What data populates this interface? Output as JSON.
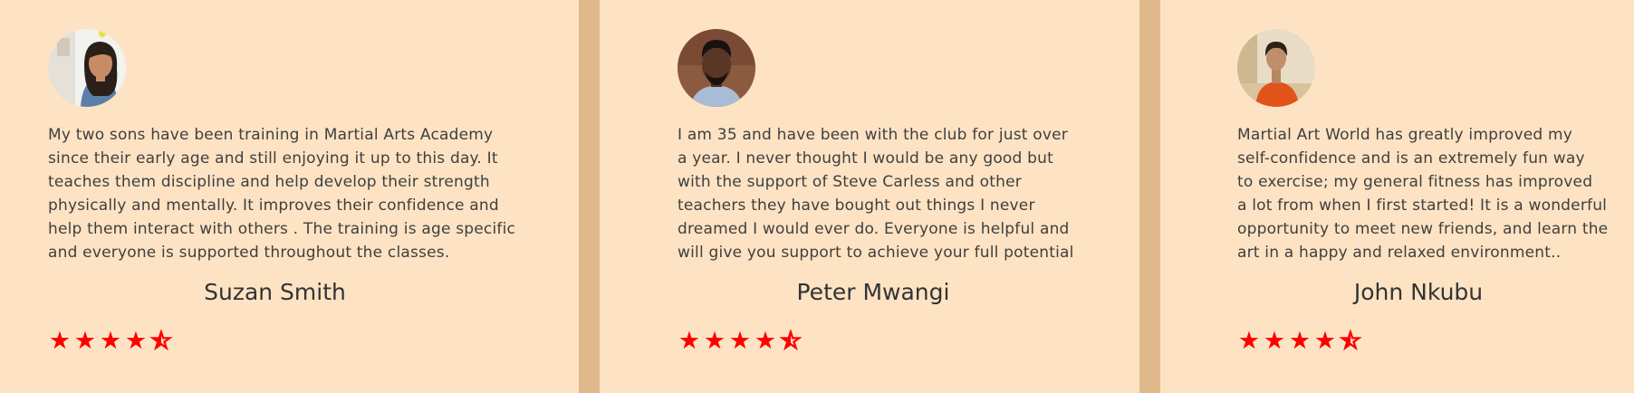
{
  "testimonials": [
    {
      "avatar_icon": "avatar-woman-photo",
      "quote_lines": [
        "My two sons have been training in Martial Arts Academy",
        "since their early age and still enjoying it up to this day. It",
        "teaches them discipline and help develop their strength",
        "physically and mentally. It improves their confidence and",
        "help them interact with others . The training is age specific",
        "and everyone is supported throughout the classes."
      ],
      "name": "Suzan Smith",
      "rating": 4.5,
      "stars": [
        "★",
        "★",
        "★",
        "★"
      ],
      "half_star": "★"
    },
    {
      "avatar_icon": "avatar-man-photo",
      "quote_lines": [
        "I am 35 and have been with the club for just over",
        "a year. I never thought I would be any good but",
        "with the support of Steve Carless and other",
        "teachers they have bought out things I never",
        "dreamed I would ever do. Everyone is helpful and",
        "will give you support to achieve your full potential"
      ],
      "name": "Peter Mwangi",
      "rating": 4.5,
      "stars": [
        "★",
        "★",
        "★",
        "★"
      ],
      "half_star": "★"
    },
    {
      "avatar_icon": "avatar-woman-orange-shirt-photo",
      "quote_lines": [
        "Martial Art World has greatly improved my",
        "self-confidence and is an extremely fun way",
        "to exercise; my general fitness has improved",
        "a lot from when I first started! It is a wonderful",
        "opportunity to meet new friends, and learn the",
        "art in a happy and relaxed environment.."
      ],
      "name": "John Nkubu",
      "rating": 4.5,
      "stars": [
        "★",
        "★",
        "★",
        "★"
      ],
      "half_star": "★"
    }
  ],
  "colors": {
    "card_background": "#fde3c3",
    "divider": "#e0b98a",
    "star": "#ff0000",
    "text": "#3f3f3f"
  }
}
